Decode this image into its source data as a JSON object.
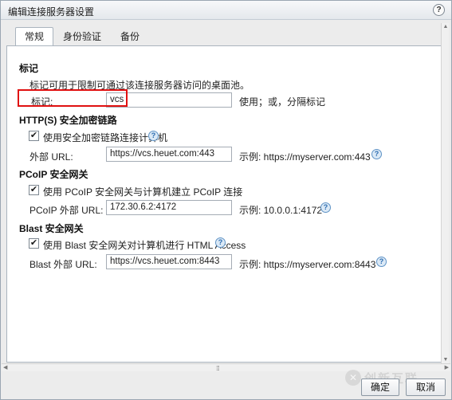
{
  "window": {
    "title": "编辑连接服务器设置",
    "help_glyph": "?"
  },
  "tabs": [
    {
      "label": "常规",
      "active": true
    },
    {
      "label": "身份验证",
      "active": false
    },
    {
      "label": "备份",
      "active": false
    }
  ],
  "tags": {
    "heading": "标记",
    "description": "标记可用于限制可通过该连接服务器访问的桌面池。",
    "field_label": "标记:",
    "value": "vcs",
    "hint": "使用；或，分隔标记"
  },
  "https": {
    "heading": "HTTP(S) 安全加密链路",
    "checkbox_label": "使用安全加密链路连接计算机",
    "checked": true,
    "url_label": "外部 URL:",
    "url_value": "https://vcs.heuet.com:443",
    "example": "示例: https://myserver.com:443"
  },
  "pcoip": {
    "heading": "PCoIP 安全网关",
    "checkbox_label": "使用 PCoIP 安全网关与计算机建立 PCoIP 连接",
    "checked": true,
    "url_label": "PCoIP 外部 URL:",
    "url_value": "172.30.6.2:4172",
    "example": "示例: 10.0.0.1:4172"
  },
  "blast": {
    "heading": "Blast 安全网关",
    "checkbox_label": "使用 Blast 安全网关对计算机进行 HTML Access",
    "checked": true,
    "url_label": "Blast 外部 URL:",
    "url_value": "https://vcs.heuet.com:8443",
    "example": "示例: https://myserver.com:8443"
  },
  "footer": {
    "ok_label": "确定",
    "cancel_label": "取消"
  },
  "watermark": {
    "text": "创新互联"
  },
  "glyphs": {
    "check": "✔",
    "question": "?",
    "grip": "⁞⁞⁞",
    "arrow_up": "▲",
    "arrow_down": "▼",
    "arrow_left": "◀",
    "arrow_right": "▶"
  },
  "colors": {
    "highlight_box": "#e01010",
    "help_icon": "#2a6bb0"
  }
}
